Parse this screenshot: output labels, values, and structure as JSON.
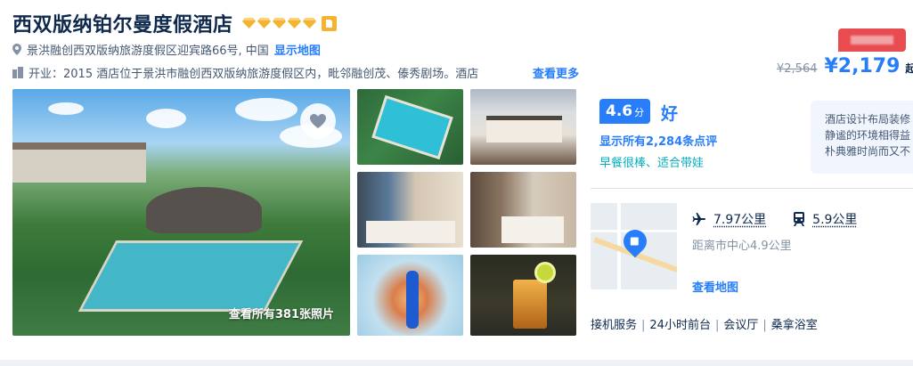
{
  "hotel": {
    "name": "西双版纳铂尔曼度假酒店",
    "diamond_count": 5,
    "address": "景洪融创西双版纳旅游度假区迎宾路66号, 中国",
    "show_map_label": "显示地图",
    "intro": "开业：2015  酒店位于景洪市融创西双版纳旅游度假区内，毗邻融创茂、傣秀剧场。酒店",
    "more_label": "查看更多"
  },
  "price": {
    "original": "¥2,564",
    "current": "¥2,179",
    "suffix": "起"
  },
  "gallery": {
    "view_all_label": "查看所有381张照片"
  },
  "rating": {
    "score": "4.6",
    "unit": "分",
    "grade": "好",
    "reviews_label": "显示所有2,284条点评",
    "tags": "早餐很棒、适合带娃",
    "quote_lines": [
      "酒店设计布局装修",
      "静谧的环境相得益",
      "朴典雅时尚而又不"
    ]
  },
  "location": {
    "airport_distance": "7.97公里",
    "station_distance": "5.9公里",
    "center_distance": "距离市中心4.9公里",
    "map_label": "查看地图"
  },
  "amenities": [
    "接机服务",
    "24小时前台",
    "会议厅",
    "桑拿浴室"
  ],
  "colors": {
    "accent": "#287dfa",
    "diamond": "#f4b430",
    "tag_teal": "#06aebd",
    "promo_red": "#e84b50"
  }
}
